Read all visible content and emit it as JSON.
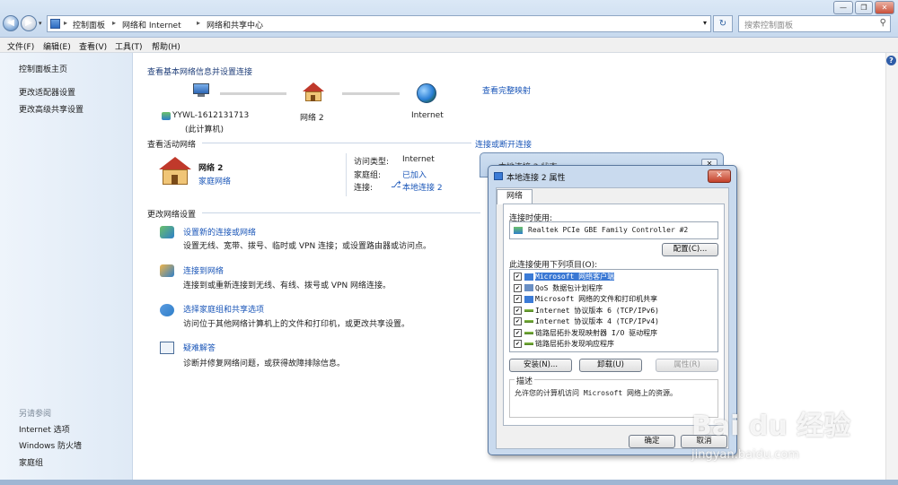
{
  "address_bar": {
    "crumbs": [
      "控制面板",
      "网络和 Internet",
      "网络和共享中心"
    ],
    "search_placeholder": "搜索控制面板"
  },
  "menu": [
    "文件(F)",
    "编辑(E)",
    "查看(V)",
    "工具(T)",
    "帮助(H)"
  ],
  "sidebar": {
    "top_links": [
      "控制面板主页",
      "更改适配器设置",
      "更改高级共享设置"
    ],
    "see_also_heading": "另请参阅",
    "see_also_links": [
      "Internet 选项",
      "Windows 防火墙",
      "家庭组"
    ]
  },
  "main": {
    "title": "查看基本网络信息并设置连接",
    "full_map_link": "查看完整映射",
    "map": {
      "computer_name": "YYWL-1612131713",
      "computer_sub": "(此计算机)",
      "network_name": "网络  2",
      "internet": "Internet"
    },
    "active_networks": {
      "heading": "查看活动网络",
      "connect_link": "连接或断开连接",
      "network_name": "网络  2",
      "network_type": "家庭网络",
      "access_type_label": "访问类型:",
      "access_type_value": "Internet",
      "homegroup_label": "家庭组:",
      "homegroup_value": "已加入",
      "connection_label": "连接:",
      "connection_value": "本地连接 2"
    },
    "change_settings": {
      "heading": "更改网络设置",
      "tasks": [
        {
          "title": "设置新的连接或网络",
          "desc": "设置无线、宽带、拨号、临时或 VPN 连接；或设置路由器或访问点。"
        },
        {
          "title": "连接到网络",
          "desc": "连接到或重新连接到无线、有线、拨号或 VPN 网络连接。"
        },
        {
          "title": "选择家庭组和共享选项",
          "desc": "访问位于其他网络计算机上的文件和打印机，或更改共享设置。"
        },
        {
          "title": "疑难解答",
          "desc": "诊断并修复网络问题，或获得故障排除信息。"
        }
      ]
    }
  },
  "dialog": {
    "back_title": "本地连接 2 状态",
    "title": "本地连接 2 属性",
    "tab": "网络",
    "connect_using_label": "连接时使用:",
    "adapter": "Realtek PCIe GBE Family Controller #2",
    "configure_button": "配置(C)...",
    "items_label": "此连接使用下列项目(O):",
    "items": [
      {
        "label": "Microsoft 网络客户端",
        "checked": true,
        "selected": true
      },
      {
        "label": "QoS 数据包计划程序",
        "checked": true,
        "selected": false
      },
      {
        "label": "Microsoft 网络的文件和打印机共享",
        "checked": true,
        "selected": false
      },
      {
        "label": "Internet 协议版本 6 (TCP/IPv6)",
        "checked": true,
        "selected": false
      },
      {
        "label": "Internet 协议版本 4 (TCP/IPv4)",
        "checked": true,
        "selected": false
      },
      {
        "label": "链路层拓扑发现映射器 I/O 驱动程序",
        "checked": true,
        "selected": false
      },
      {
        "label": "链路层拓扑发现响应程序",
        "checked": true,
        "selected": false
      }
    ],
    "install_button": "安装(N)...",
    "uninstall_button": "卸载(U)",
    "properties_button": "属性(R)",
    "description_label": "描述",
    "description": "允许您的计算机访问 Microsoft 网络上的资源。",
    "ok_button": "确定",
    "cancel_button": "取消"
  },
  "watermark": {
    "brand": "Bai du 经验",
    "url": "jingyan.baidu.com"
  },
  "colors": {
    "accent_link": "#1a56b8",
    "sidebar_bg": "#e6eff9",
    "selection": "#3a78d4",
    "close_red": "#c4412a"
  }
}
